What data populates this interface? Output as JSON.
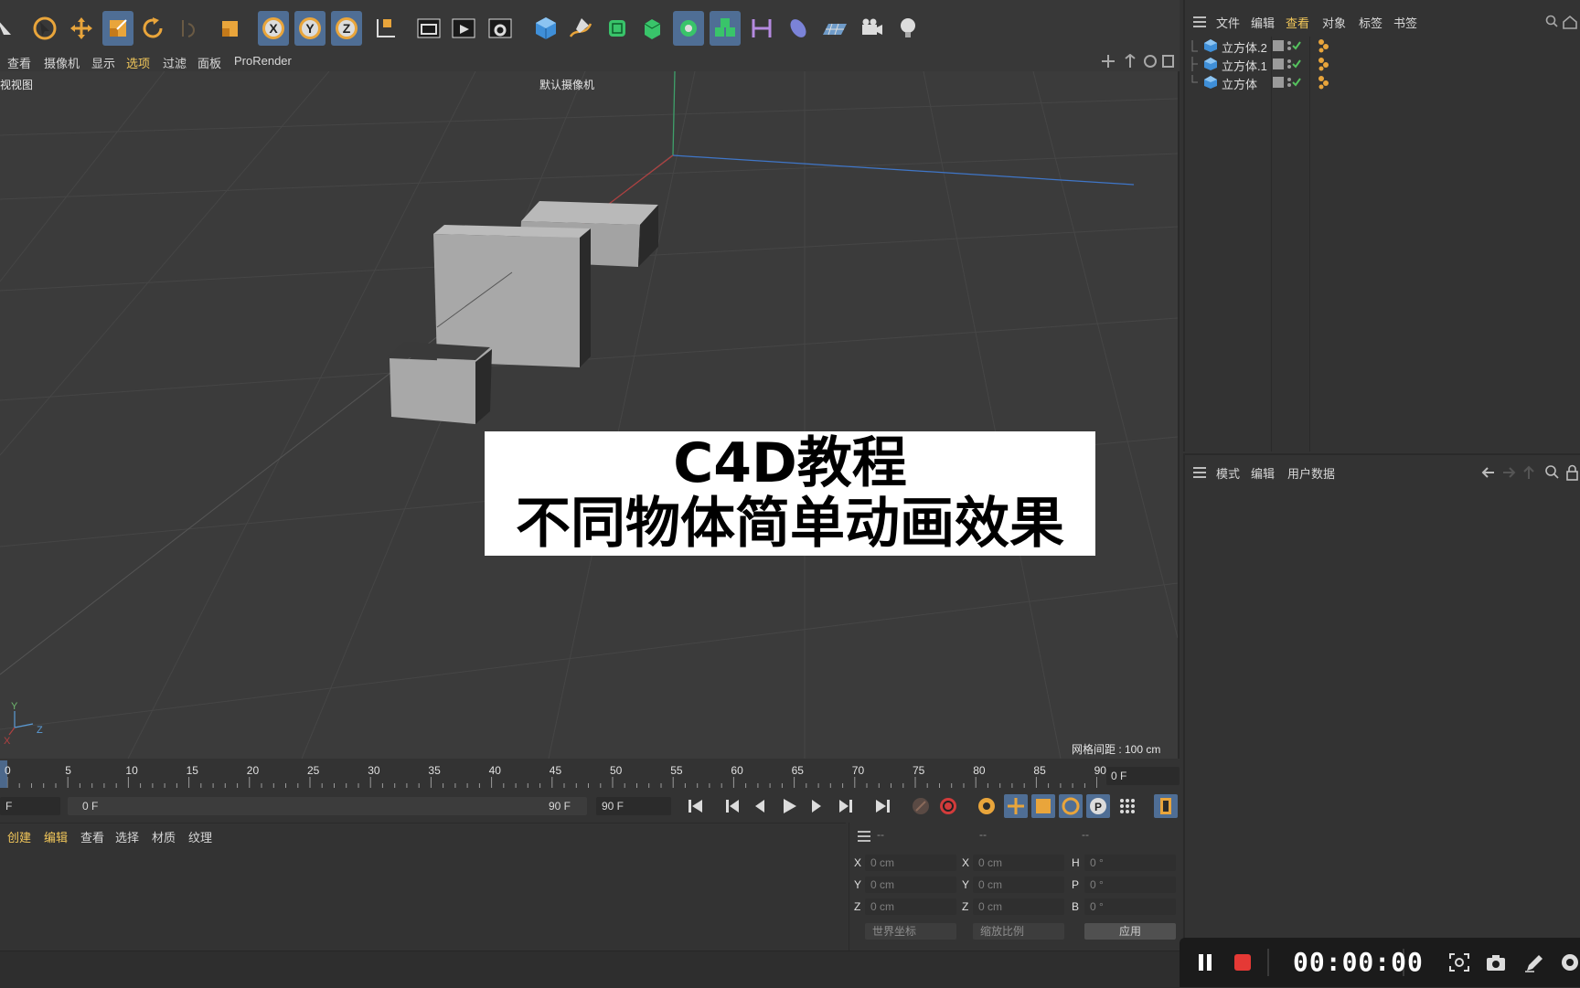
{
  "app": {
    "accent": "#f2c75a",
    "selection_blue": "#4f6e95"
  },
  "toolbar": {
    "icons": [
      "arrow-icon",
      "select-cursor-icon",
      "move-icon",
      "scale-icon",
      "rotate-icon",
      "disabled-tool-icon",
      "last-tool-icon",
      "x-axis-lock-icon",
      "y-axis-lock-icon",
      "z-axis-lock-icon",
      "coordinate-system-icon",
      "render-view-icon",
      "render-picture-queue-icon",
      "render-settings-icon",
      "cube-icon",
      "pen-spline-icon",
      "subdivision-icon",
      "extrude-icon",
      "deformer-icon",
      "array-icon",
      "mograph-icon",
      "field-icon",
      "floor-icon",
      "camera-icon",
      "light-icon"
    ]
  },
  "viewport": {
    "menu": [
      "查看",
      "摄像机",
      "显示",
      "选项",
      "过滤",
      "面板",
      "ProRender"
    ],
    "menu_highlight": "选项",
    "label": "视视图",
    "camera": "默认摄像机",
    "grid_spacing": "网格间距 : 100 cm",
    "axis_y": "Y",
    "axis_z": "Z",
    "axis_x": "X"
  },
  "title_card": {
    "line1": "C4D教程",
    "line2": "不同物体简单动画效果"
  },
  "timeline": {
    "ticks": [
      "0",
      "5",
      "10",
      "15",
      "20",
      "25",
      "30",
      "35",
      "40",
      "45",
      "50",
      "55",
      "60",
      "65",
      "70",
      "75",
      "80",
      "85",
      "90"
    ],
    "current_frame": "0 F"
  },
  "transport": {
    "start_field": "F",
    "range_start": "0 F",
    "range_end": "90 F",
    "end_field": "90 F"
  },
  "material": {
    "menu": [
      "创建",
      "编辑",
      "查看",
      "选择",
      "材质",
      "纹理"
    ],
    "highlight": [
      "创建",
      "编辑"
    ]
  },
  "coords": {
    "headers": [
      "--",
      "--",
      "--"
    ],
    "rows": [
      {
        "a": "X",
        "v1": "0 cm",
        "b": "X",
        "v2": "0 cm",
        "c": "H",
        "v3": "0 °"
      },
      {
        "a": "Y",
        "v1": "0 cm",
        "b": "Y",
        "v2": "0 cm",
        "c": "P",
        "v3": "0 °"
      },
      {
        "a": "Z",
        "v1": "0 cm",
        "b": "Z",
        "v2": "0 cm",
        "c": "B",
        "v3": "0 °"
      }
    ],
    "world_select": "世界坐标",
    "scale_select": "缩放比例",
    "apply": "应用"
  },
  "object_manager": {
    "menu": [
      "文件",
      "编辑",
      "查看",
      "对象",
      "标签",
      "书签"
    ],
    "highlight": "查看",
    "objects": [
      "立方体.2",
      "立方体.1",
      "立方体"
    ]
  },
  "attribute_manager": {
    "menu": [
      "模式",
      "编辑",
      "用户数据"
    ]
  },
  "recorder": {
    "time": "00:00:00"
  }
}
